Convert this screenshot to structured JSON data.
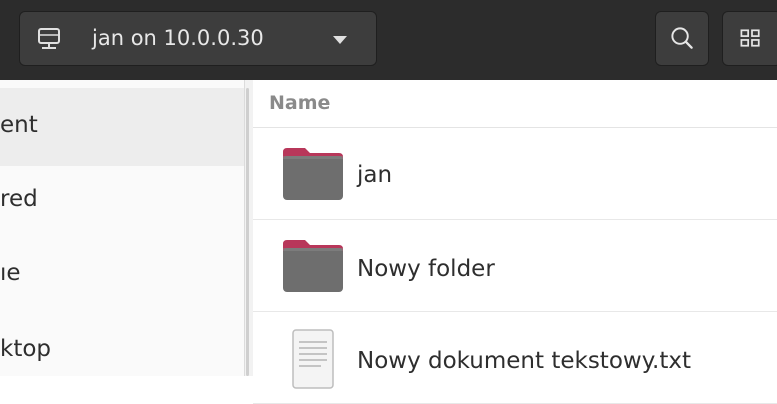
{
  "header": {
    "location_label": "jan on 10.0.0.30",
    "location_icon": "network-drive-icon",
    "dropdown_icon": "chevron-down-icon",
    "search_icon": "search-icon",
    "view_icon": "grid-view-icon"
  },
  "sidebar": {
    "items": [
      {
        "label": "ent",
        "active": true
      },
      {
        "label": "red",
        "active": false
      },
      {
        "label": "ıe",
        "active": false
      },
      {
        "label": "ktop",
        "active": false
      }
    ]
  },
  "main": {
    "column_name": "Name",
    "files": [
      {
        "name": "jan",
        "type": "folder-icon"
      },
      {
        "name": "Nowy folder",
        "type": "folder-icon"
      },
      {
        "name": "Nowy dokument tekstowy.txt",
        "type": "text-file-icon"
      }
    ]
  },
  "colors": {
    "headerbar": "#2c2c2c",
    "folder_tab": "#b8375a",
    "folder_body": "#6e6e6e"
  }
}
